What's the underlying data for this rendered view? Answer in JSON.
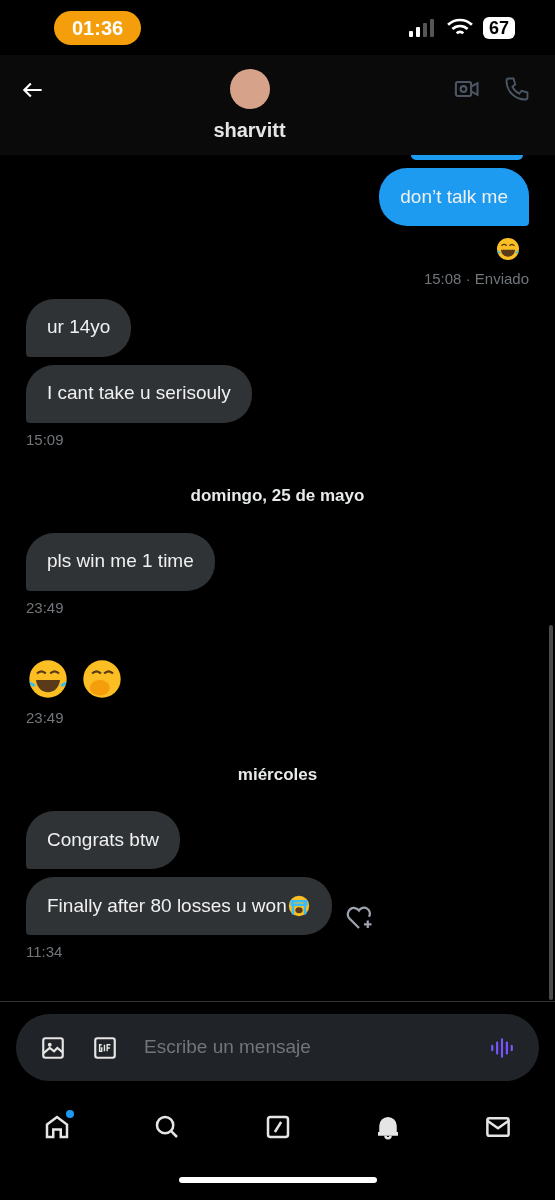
{
  "status_bar": {
    "time": "01:36",
    "battery": "67"
  },
  "header": {
    "name": "sharvitt"
  },
  "messages": [
    {
      "kind": "sent_partial"
    },
    {
      "kind": "sent_text",
      "text": "don’t talk me"
    },
    {
      "kind": "sent_reaction"
    },
    {
      "kind": "sent_meta",
      "text": "15:08 · Enviado"
    },
    {
      "kind": "received_text",
      "text": "ur 14yo"
    },
    {
      "kind": "received_text",
      "text": "I cant take u serisouly"
    },
    {
      "kind": "received_meta",
      "text": "15:09"
    },
    {
      "kind": "date",
      "text": "domingo, 25 de mayo"
    },
    {
      "kind": "received_text",
      "text": "pls win me 1 time"
    },
    {
      "kind": "received_meta",
      "text": "23:49"
    },
    {
      "kind": "received_emojis"
    },
    {
      "kind": "received_meta",
      "text": "23:49"
    },
    {
      "kind": "date",
      "text": "miércoles"
    },
    {
      "kind": "received_text",
      "text": "Congrats btw"
    },
    {
      "kind": "received_text_emoji",
      "text": "Finally after 80 losses u won",
      "react_button": true
    },
    {
      "kind": "received_meta",
      "text": "11:34"
    }
  ],
  "composer": {
    "placeholder": "Escribe un mensaje"
  },
  "nav": [
    {
      "badge": true
    },
    {
      "badge": false
    },
    {
      "badge": false
    },
    {
      "badge": false
    },
    {
      "badge": false
    }
  ]
}
